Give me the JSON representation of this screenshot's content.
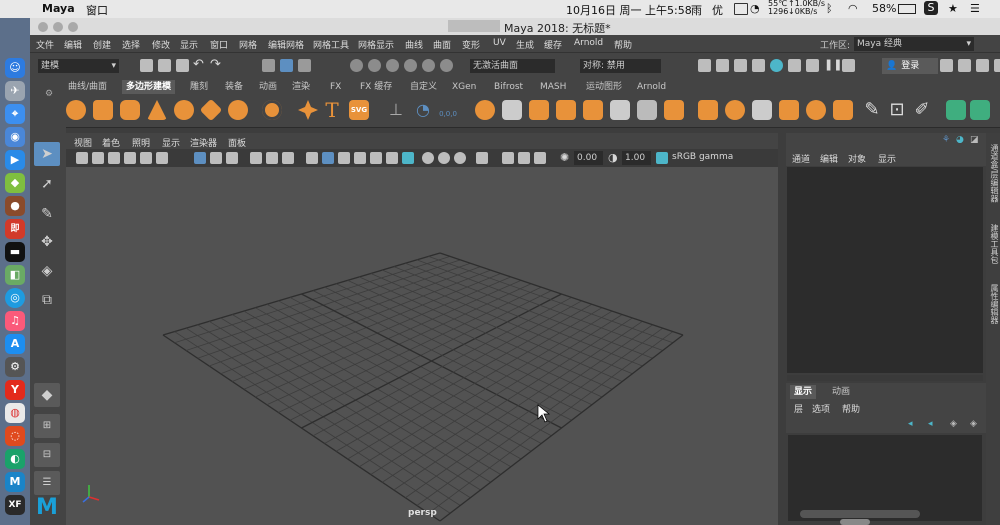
{
  "mac_menubar": {
    "app_name": "Maya",
    "menu_window": "窗口",
    "temperature": "55℃",
    "rpm": "1296",
    "net_up": "↑1.0KB/s",
    "net_down": "↓0KB/s",
    "datetime": "10月16日 周一 上午5:58",
    "weather": "雨",
    "ime": "优",
    "battery": "58%"
  },
  "window_title": "Maya 2018: 无标题*",
  "main_menu": [
    "文件",
    "编辑",
    "创建",
    "选择",
    "修改",
    "显示",
    "窗口",
    "网格",
    "编辑网格",
    "网格工具",
    "网格显示",
    "曲线",
    "曲面",
    "变形",
    "UV",
    "生成",
    "缓存",
    "Arnold",
    "帮助"
  ],
  "workspace": {
    "label": "工作区:",
    "value": "Maya 经典"
  },
  "status_line": {
    "mode": "建模",
    "live_surface": "无激活曲面",
    "symmetry": "对称: 禁用",
    "login": "登录"
  },
  "shelf_tabs": [
    "曲线/曲面",
    "多边形建模",
    "雕刻",
    "装备",
    "动画",
    "渲染",
    "FX",
    "FX 缓存",
    "自定义",
    "XGen",
    "Bifrost",
    "MASH",
    "运动图形",
    "Arnold"
  ],
  "shelf_active_tab": "多边形建模",
  "shelf_text_icons": {
    "text_tool": "T",
    "svg_tool": "SVG",
    "zero": "0,0,0"
  },
  "viewport": {
    "menu": [
      "视图",
      "着色",
      "照明",
      "显示",
      "渲染器",
      "面板"
    ],
    "exposure": "0.00",
    "gamma": "1.00",
    "color_space": "sRGB gamma",
    "camera": "persp"
  },
  "channel_box": {
    "menu": [
      "通道",
      "编辑",
      "对象",
      "显示"
    ]
  },
  "layer_editor": {
    "tabs": [
      "显示",
      "动画"
    ],
    "active_tab": "显示",
    "menu": [
      "层",
      "选项",
      "帮助"
    ]
  },
  "side_tabs": [
    "通道盒/层编辑器",
    "建模工具包",
    "属性编辑器"
  ],
  "colors": {
    "maya_bg": "#444444",
    "viewport_bg": "#525252",
    "accent_orange": "#e8923a",
    "selection_blue": "#5d8fc1"
  }
}
